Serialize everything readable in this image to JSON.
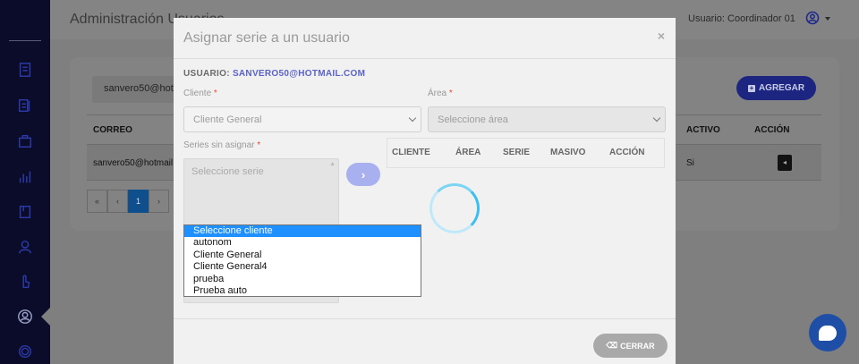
{
  "header": {
    "page_title": "Administración Usuarios",
    "user_label": "Usuario: Coordinador 01"
  },
  "background": {
    "email_filter_value": "sanvero50@hotmail.com",
    "add_button_label": "AGREGAR",
    "table_headers": [
      "CORREO",
      "ACTIVO",
      "ACCIÓN"
    ],
    "row": {
      "correo": "sanvero50@hotmail.com",
      "activo": "Si"
    },
    "pager": [
      "«",
      "‹",
      "1",
      "›"
    ]
  },
  "modal": {
    "title": "Asignar serie a un usuario",
    "close": "×",
    "usuario_prefix": "USUARIO:",
    "usuario_email": "SANVERO50@HOTMAIL.COM",
    "cliente_label": "Cliente",
    "cliente_value": "Cliente General",
    "area_label": "Área",
    "area_placeholder": "Seleccione área",
    "series_label": "Series sin asignar",
    "series_placeholder": "Seleccione serie",
    "move_button": "›",
    "series_table_headers": [
      "CLIENTE",
      "ÁREA",
      "SERIE",
      "MASIVO",
      "ACCIÓN"
    ],
    "required_mark": "*",
    "close_button_label": "CERRAR"
  },
  "cliente_dropdown": {
    "options": [
      "Seleccione cliente",
      "autonom",
      "Cliente General",
      "Cliente General4",
      "prueba",
      "Prueba auto"
    ],
    "highlighted_index": 0
  },
  "colors": {
    "accent": "#5b63c9",
    "sidebar": "#0b0c2a",
    "highlight": "#1e90ff"
  }
}
